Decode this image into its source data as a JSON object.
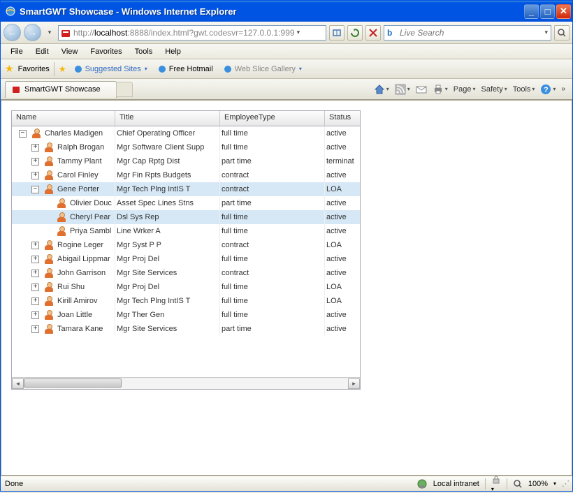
{
  "window": {
    "title": "SmartGWT Showcase - Windows Internet Explorer"
  },
  "address": {
    "prefix": "http://",
    "host": "localhost",
    "rest": ":8888/index.html?gwt.codesvr=127.0.0.1:999"
  },
  "search": {
    "placeholder": "Live Search"
  },
  "menu": {
    "file": "File",
    "edit": "Edit",
    "view": "View",
    "favorites": "Favorites",
    "tools": "Tools",
    "help": "Help"
  },
  "favbar": {
    "label": "Favorites",
    "suggested": "Suggested Sites",
    "hotmail": "Free Hotmail",
    "webslice": "Web Slice Gallery"
  },
  "tab": {
    "title": "SmartGWT Showcase"
  },
  "commands": {
    "page": "Page",
    "safety": "Safety",
    "tools": "Tools"
  },
  "grid": {
    "headers": {
      "name": "Name",
      "title": "Title",
      "type": "EmployeeType",
      "status": "Status"
    },
    "rows": [
      {
        "indent": 0,
        "toggle": "minus",
        "name": "Charles Madigen",
        "title": "Chief Operating Officer",
        "type": "full time",
        "status": "active",
        "sel": false
      },
      {
        "indent": 1,
        "toggle": "plus",
        "name": "Ralph Brogan",
        "title": "Mgr Software Client Supp",
        "type": "full time",
        "status": "active",
        "sel": false
      },
      {
        "indent": 1,
        "toggle": "plus",
        "name": "Tammy Plant",
        "title": "Mgr Cap Rptg Dist",
        "type": "part time",
        "status": "terminat",
        "sel": false
      },
      {
        "indent": 1,
        "toggle": "plus",
        "name": "Carol Finley",
        "title": "Mgr Fin Rpts Budgets",
        "type": "contract",
        "status": "active",
        "sel": false
      },
      {
        "indent": 1,
        "toggle": "minus",
        "name": "Gene Porter",
        "title": "Mgr Tech Plng IntIS T",
        "type": "contract",
        "status": "LOA",
        "sel": true
      },
      {
        "indent": 2,
        "toggle": "none",
        "name": "Olivier Douc",
        "title": "Asset Spec Lines Stns",
        "type": "part time",
        "status": "active",
        "sel": false
      },
      {
        "indent": 2,
        "toggle": "none",
        "name": "Cheryl Pear",
        "title": "Dsl Sys Rep",
        "type": "full time",
        "status": "active",
        "sel": true
      },
      {
        "indent": 2,
        "toggle": "none",
        "name": "Priya Sambl",
        "title": "Line Wrker A",
        "type": "full time",
        "status": "active",
        "sel": false
      },
      {
        "indent": 1,
        "toggle": "plus",
        "name": "Rogine Leger",
        "title": "Mgr Syst P P",
        "type": "contract",
        "status": "LOA",
        "sel": false
      },
      {
        "indent": 1,
        "toggle": "plus",
        "name": "Abigail Lippmar",
        "title": "Mgr Proj Del",
        "type": "full time",
        "status": "active",
        "sel": false
      },
      {
        "indent": 1,
        "toggle": "plus",
        "name": "John Garrison",
        "title": "Mgr Site Services",
        "type": "contract",
        "status": "active",
        "sel": false
      },
      {
        "indent": 1,
        "toggle": "plus",
        "name": "Rui Shu",
        "title": "Mgr Proj Del",
        "type": "full time",
        "status": "LOA",
        "sel": false
      },
      {
        "indent": 1,
        "toggle": "plus",
        "name": "Kirill Amirov",
        "title": "Mgr Tech Plng IntIS T",
        "type": "full time",
        "status": "LOA",
        "sel": false
      },
      {
        "indent": 1,
        "toggle": "plus",
        "name": "Joan Little",
        "title": "Mgr Ther Gen",
        "type": "full time",
        "status": "active",
        "sel": false
      },
      {
        "indent": 1,
        "toggle": "plus",
        "name": "Tamara Kane",
        "title": "Mgr Site Services",
        "type": "part time",
        "status": "active",
        "sel": false
      }
    ]
  },
  "statusbar": {
    "done": "Done",
    "zone": "Local intranet",
    "zoom": "100%"
  }
}
